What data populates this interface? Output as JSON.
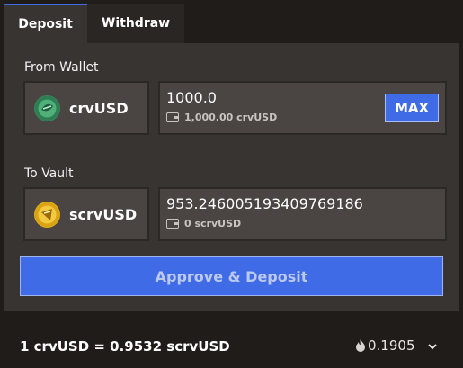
{
  "tabs": [
    {
      "label": "Deposit",
      "active": true
    },
    {
      "label": "Withdraw",
      "active": false
    }
  ],
  "from": {
    "label": "From Wallet",
    "token": {
      "symbol": "crvUSD",
      "icon": "crvusd-token-icon",
      "color": "#3a8f5e"
    },
    "amount": "1000.0",
    "balance": "1,000.00 crvUSD",
    "max_label": "MAX"
  },
  "arrow": "↓",
  "to": {
    "label": "To Vault",
    "token": {
      "symbol": "scrvUSD",
      "icon": "scrvusd-token-icon",
      "color": "#e8b31a"
    },
    "amount": "953.246005193409769186",
    "balance": "0 scrvUSD"
  },
  "action": {
    "label": "Approve & Deposit",
    "color": "#3f6be6"
  },
  "footer": {
    "rate": "1 crvUSD = 0.9532 scrvUSD",
    "apy": "0.1905"
  }
}
